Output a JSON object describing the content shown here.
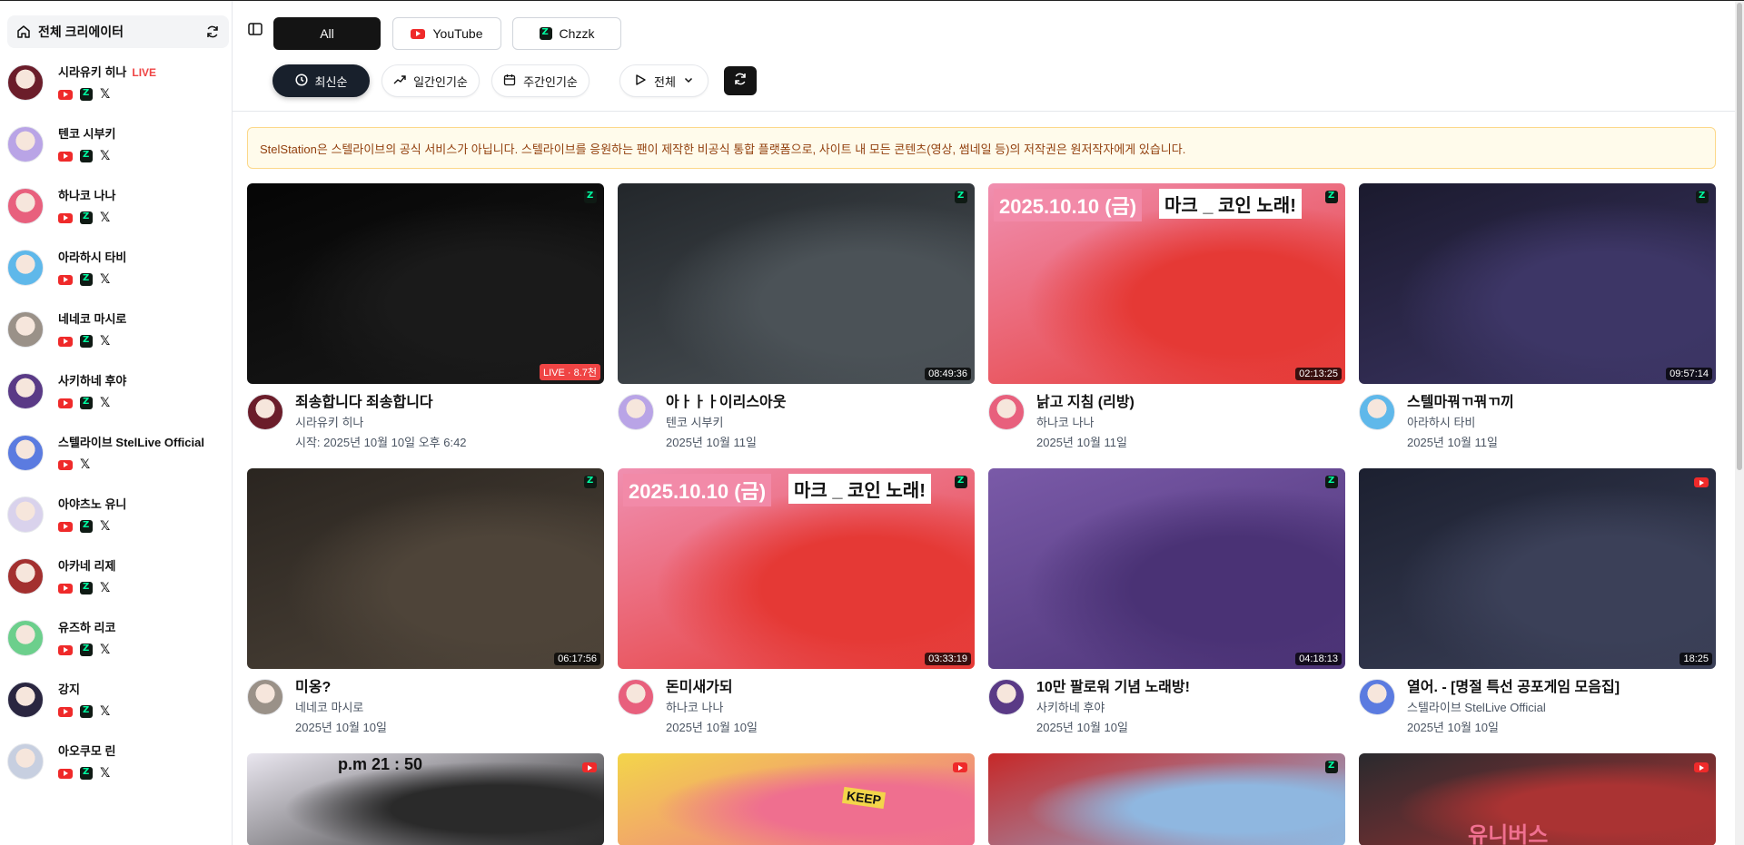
{
  "sidebar": {
    "header_label": "전체 크리에이터",
    "creators": [
      {
        "name": "시라유키 히나",
        "live": "LIVE",
        "platforms": [
          "youtube",
          "chzzk",
          "x"
        ],
        "color": "#6b1d2a"
      },
      {
        "name": "텐코 시부키",
        "live": "",
        "platforms": [
          "youtube",
          "chzzk",
          "x"
        ],
        "color": "#b9a4e6"
      },
      {
        "name": "하나코 나나",
        "live": "",
        "platforms": [
          "youtube",
          "chzzk",
          "x"
        ],
        "color": "#e8607d"
      },
      {
        "name": "아라하시 타비",
        "live": "",
        "platforms": [
          "youtube",
          "chzzk",
          "x"
        ],
        "color": "#5fb8ea"
      },
      {
        "name": "네네코 마시로",
        "live": "",
        "platforms": [
          "youtube",
          "chzzk",
          "x"
        ],
        "color": "#9a9188"
      },
      {
        "name": "사키하네 후야",
        "live": "",
        "platforms": [
          "youtube",
          "chzzk",
          "x"
        ],
        "color": "#5a3a86"
      },
      {
        "name": "스텔라이브 StelLive Official",
        "live": "",
        "platforms": [
          "youtube",
          "x"
        ],
        "color": "#5b7be0"
      },
      {
        "name": "아야츠노 유니",
        "live": "",
        "platforms": [
          "youtube",
          "chzzk",
          "x"
        ],
        "color": "#d9d2ec"
      },
      {
        "name": "아카네 리제",
        "live": "",
        "platforms": [
          "youtube",
          "chzzk",
          "x"
        ],
        "color": "#a3302f"
      },
      {
        "name": "유즈하 리코",
        "live": "",
        "platforms": [
          "youtube",
          "chzzk",
          "x"
        ],
        "color": "#6ccf8c"
      },
      {
        "name": "강지",
        "live": "",
        "platforms": [
          "youtube",
          "chzzk",
          "x"
        ],
        "color": "#2a2640"
      },
      {
        "name": "아오쿠모 린",
        "live": "",
        "platforms": [
          "youtube",
          "chzzk",
          "x"
        ],
        "color": "#c7cfe0"
      }
    ]
  },
  "tabs": [
    {
      "label": "All",
      "icon": "none"
    },
    {
      "label": "YouTube",
      "icon": "youtube-icon"
    },
    {
      "label": "Chzzk",
      "icon": "chzzk-icon"
    }
  ],
  "filters": {
    "latest": "최신순",
    "daily": "일간인기순",
    "weekly": "주간인기순",
    "type": "전체"
  },
  "notice": "StelStation은 스텔라이브의 공식 서비스가 아닙니다. 스텔라이브를 응원하는 팬이 제작한 비공식 통합 플랫폼으로, 사이트 내 모든 콘텐츠(영상, 썸네일 등)의 저작권은 원저작자에게 있습니다.",
  "videos": [
    {
      "title": "죄송합니다 죄송합니다",
      "creator": "시라유키 히나",
      "date": "시작: 2025년 10월 10일 오후 6:42",
      "duration": "LIVE · 8.7천",
      "platform": "chzzk",
      "bg": "#050505",
      "accent": "#1a1a1a",
      "avatar": "#6b1d2a"
    },
    {
      "title": "아ㅏㅏㅏ이리스아웃",
      "creator": "텐코 시부키",
      "date": "2025년 10월 11일",
      "duration": "08:49:36",
      "platform": "chzzk",
      "bg": "#23272b",
      "accent": "#4b5257",
      "avatar": "#b9a4e6"
    },
    {
      "title": "낡고 지침 (리방)",
      "creator": "하나코 나나",
      "date": "2025년 10월 11일",
      "duration": "02:13:25",
      "platform": "chzzk",
      "bg": "#f08fb0",
      "accent": "#e53935",
      "avatar": "#e8607d"
    },
    {
      "title": "스텔마꿔ㄲ꿔ㄲ끼",
      "creator": "아라하시 타비",
      "date": "2025년 10월 11일",
      "duration": "09:57:14",
      "platform": "chzzk",
      "bg": "#1b1a2e",
      "accent": "#3d3666",
      "avatar": "#5fb8ea"
    },
    {
      "title": "미옹?",
      "creator": "네네코 마시로",
      "date": "2025년 10월 10일",
      "duration": "06:17:56",
      "platform": "chzzk",
      "bg": "#2a2520",
      "accent": "#4e4439",
      "avatar": "#9a9188"
    },
    {
      "title": "돈미새가되",
      "creator": "하나코 나나",
      "date": "2025년 10월 10일",
      "duration": "03:33:19",
      "platform": "chzzk",
      "bg": "#f08fb0",
      "accent": "#e53935",
      "avatar": "#e8607d"
    },
    {
      "title": "10만 팔로워 기념 노래방!",
      "creator": "사키하네 후야",
      "date": "2025년 10월 10일",
      "duration": "04:18:13",
      "platform": "chzzk",
      "bg": "#7a5aa8",
      "accent": "#4a3275",
      "avatar": "#5a3a86"
    },
    {
      "title": "열어. - [명절 특선 공포게임 모음집]",
      "creator": "스텔라이브 StelLive Official",
      "date": "2025년 10월 10일",
      "duration": "18:25",
      "platform": "youtube",
      "bg": "#1c2030",
      "accent": "#3b4058",
      "avatar": "#5b7be0"
    },
    {
      "title": "",
      "creator": "",
      "date": "",
      "duration": "",
      "platform": "youtube",
      "bg": "#e9e6ef",
      "accent": "#2a2a2a",
      "avatar": ""
    },
    {
      "title": "",
      "creator": "",
      "date": "",
      "duration": "",
      "platform": "youtube",
      "bg": "#f3d54a",
      "accent": "#ef6f8f",
      "avatar": ""
    },
    {
      "title": "",
      "creator": "",
      "date": "",
      "duration": "",
      "platform": "chzzk",
      "bg": "#c62828",
      "accent": "#8fb7e0",
      "avatar": ""
    },
    {
      "title": "",
      "creator": "",
      "date": "",
      "duration": "",
      "platform": "youtube",
      "bg": "#2a2a2e",
      "accent": "#a33",
      "avatar": ""
    }
  ],
  "thumbnail_overlays": {
    "date_banner": "2025.10.10 (금)",
    "stream_banner": "마크 _ 코인 노래!",
    "time_label": "p.m 21 : 50",
    "logo_text": "유니버스",
    "keep_sign": "KEEP"
  }
}
